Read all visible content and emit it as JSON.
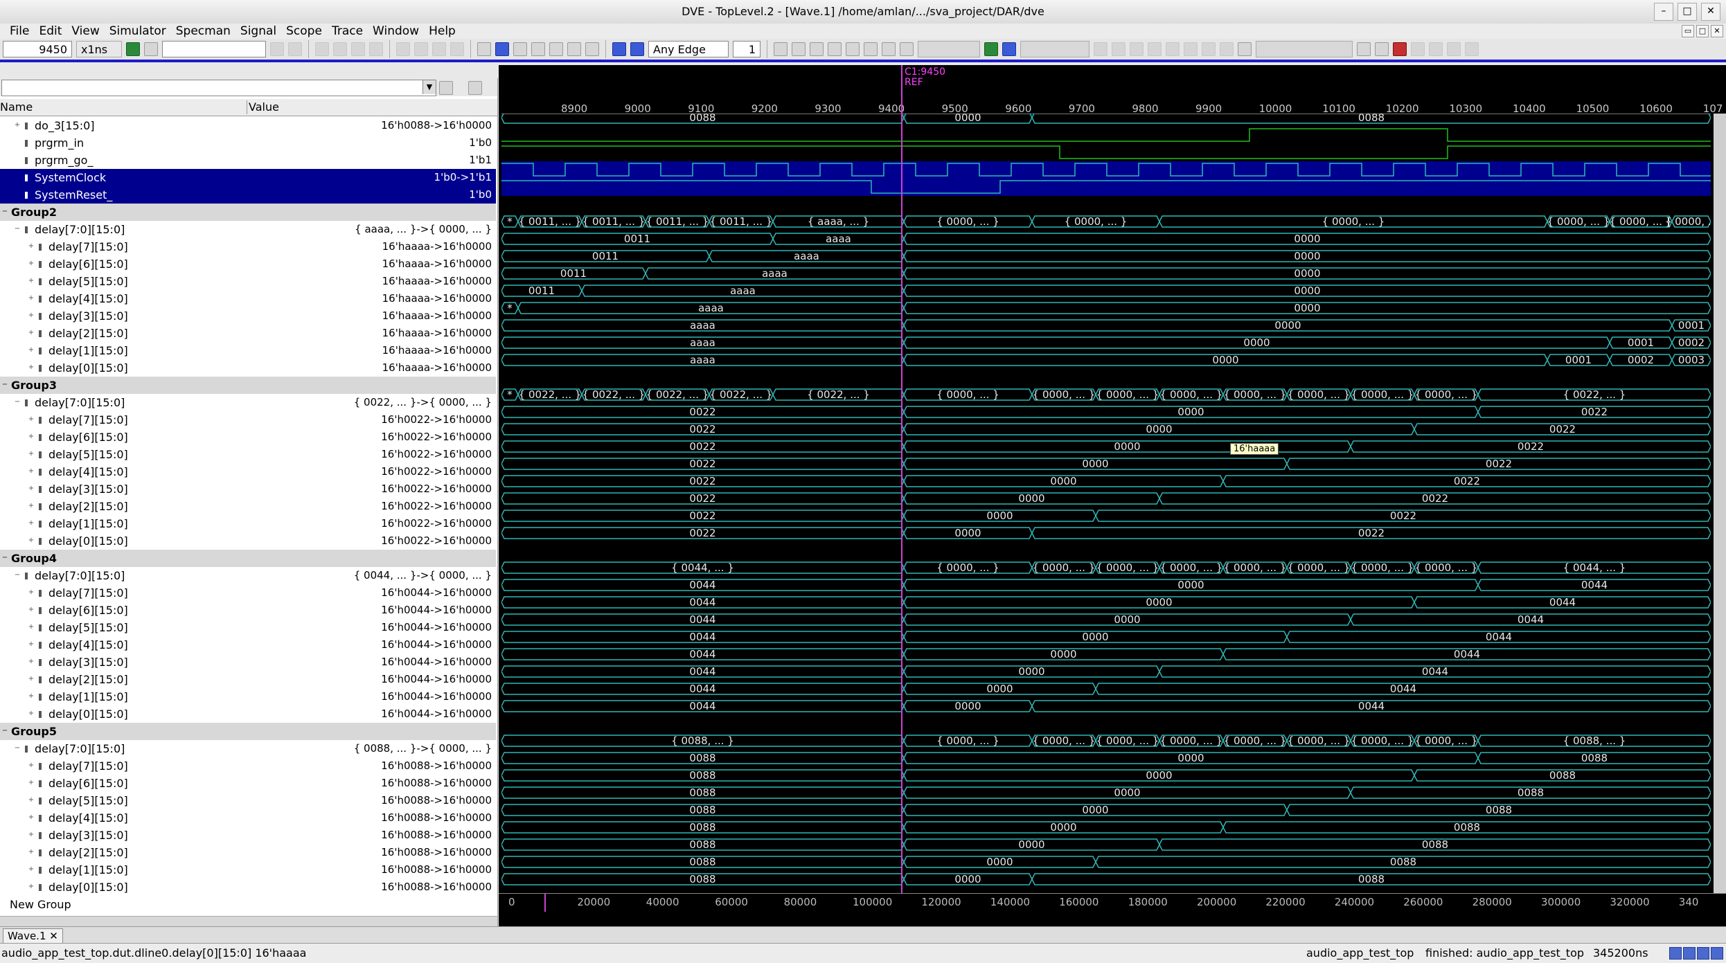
{
  "window": {
    "title": "DVE - TopLevel.2 - [Wave.1]  /home/amlan/.../sva_project/DAR/dve"
  },
  "menu": [
    "File",
    "Edit",
    "View",
    "Simulator",
    "Specman",
    "Signal",
    "Scope",
    "Trace",
    "Window",
    "Help"
  ],
  "toolbar": {
    "time_value": "9450",
    "time_unit": "x1ns",
    "edge_select": "Any Edge",
    "step_count": "1"
  },
  "columns": {
    "name": "Name",
    "value": "Value"
  },
  "colors": {
    "wave": "#2fb7b7",
    "bus": "#2fb7b7",
    "level1": "#20c020",
    "selection": "#00008e",
    "cursor": "#d040d0"
  },
  "signals": [
    {
      "name": "do_3[15:0]",
      "value": "16'h0088->16'h0000",
      "indent": 1,
      "exp": "+",
      "kind": "bus",
      "segs": [
        [
          0,
          0,
          "0088"
        ],
        [
          581,
          0,
          "0000"
        ],
        [
          766,
          0,
          "0088"
        ]
      ]
    },
    {
      "name": "prgrm_in",
      "value": "1'b0",
      "indent": 1,
      "kind": "bit",
      "levels": [
        [
          0,
          0
        ],
        [
          1080,
          1
        ],
        [
          1366,
          0
        ]
      ]
    },
    {
      "name": "prgrm_go_",
      "value": "1'b1",
      "indent": 1,
      "kind": "bit",
      "levels": [
        [
          0,
          1
        ],
        [
          806,
          0
        ],
        [
          1366,
          1
        ]
      ]
    },
    {
      "name": "SystemClock",
      "value": "1'b0->1'b1",
      "indent": 1,
      "kind": "clock",
      "sel": true
    },
    {
      "name": "SystemReset_",
      "value": "1'b0",
      "indent": 1,
      "kind": "bit",
      "sel": true,
      "levels": [
        [
          0,
          1
        ],
        [
          534,
          0
        ],
        [
          720,
          1
        ]
      ]
    },
    {
      "name": "Group2",
      "kind": "group"
    },
    {
      "name": "delay[7:0][15:0]",
      "value": "{ aaaa, ... }->{ 0000, ... }",
      "indent": 1,
      "exp": "-",
      "kind": "bus",
      "segs": [
        [
          0,
          0,
          "*"
        ],
        [
          24,
          0,
          "{ 0011, ... }"
        ],
        [
          116,
          0,
          "{ 0011, ... }"
        ],
        [
          208,
          0,
          "{ 0011, ... }"
        ],
        [
          300,
          0,
          "{ 0011, ... }"
        ],
        [
          392,
          0,
          "{ aaaa, ... }"
        ],
        [
          581,
          0,
          "{ 0000, ... }"
        ],
        [
          766,
          0,
          "{ 0000, ... }"
        ],
        [
          950,
          0,
          "{ 0000, ... }"
        ],
        [
          1510,
          0,
          "{ 0000, ... }"
        ],
        [
          1600,
          0,
          "{ 0000, ... }"
        ],
        [
          1690,
          0,
          "{ 0000, ..."
        ]
      ]
    },
    {
      "name": "delay[7][15:0]",
      "value": "16'haaaa->16'h0000",
      "indent": 2,
      "exp": "+",
      "kind": "bus",
      "segs": [
        [
          0,
          0,
          "0011"
        ],
        [
          392,
          0,
          "aaaa"
        ],
        [
          581,
          0,
          "0000"
        ]
      ]
    },
    {
      "name": "delay[6][15:0]",
      "value": "16'haaaa->16'h0000",
      "indent": 2,
      "exp": "+",
      "kind": "bus",
      "segs": [
        [
          0,
          0,
          "0011"
        ],
        [
          300,
          0,
          "aaaa"
        ],
        [
          581,
          0,
          "0000"
        ]
      ]
    },
    {
      "name": "delay[5][15:0]",
      "value": "16'haaaa->16'h0000",
      "indent": 2,
      "exp": "+",
      "kind": "bus",
      "segs": [
        [
          0,
          0,
          "0011"
        ],
        [
          208,
          0,
          "aaaa"
        ],
        [
          581,
          0,
          "0000"
        ]
      ]
    },
    {
      "name": "delay[4][15:0]",
      "value": "16'haaaa->16'h0000",
      "indent": 2,
      "exp": "+",
      "kind": "bus",
      "segs": [
        [
          0,
          0,
          "0011"
        ],
        [
          116,
          0,
          "aaaa"
        ],
        [
          581,
          0,
          "0000"
        ]
      ]
    },
    {
      "name": "delay[3][15:0]",
      "value": "16'haaaa->16'h0000",
      "indent": 2,
      "exp": "+",
      "kind": "bus",
      "segs": [
        [
          0,
          0,
          "*"
        ],
        [
          24,
          0,
          "aaaa"
        ],
        [
          581,
          0,
          "0000"
        ]
      ]
    },
    {
      "name": "delay[2][15:0]",
      "value": "16'haaaa->16'h0000",
      "indent": 2,
      "exp": "+",
      "kind": "bus",
      "segs": [
        [
          0,
          0,
          "aaaa"
        ],
        [
          581,
          0,
          "0000"
        ],
        [
          1690,
          0,
          "0001"
        ]
      ]
    },
    {
      "name": "delay[1][15:0]",
      "value": "16'haaaa->16'h0000",
      "indent": 2,
      "exp": "+",
      "kind": "bus",
      "segs": [
        [
          0,
          0,
          "aaaa"
        ],
        [
          581,
          0,
          "0000"
        ],
        [
          1600,
          0,
          "0001"
        ],
        [
          1690,
          0,
          "0002"
        ]
      ]
    },
    {
      "name": "delay[0][15:0]",
      "value": "16'haaaa->16'h0000",
      "indent": 2,
      "exp": "+",
      "kind": "bus",
      "segs": [
        [
          0,
          0,
          "aaaa"
        ],
        [
          581,
          0,
          "0000"
        ],
        [
          1510,
          0,
          "0001"
        ],
        [
          1600,
          0,
          "0002"
        ],
        [
          1690,
          0,
          "0003"
        ]
      ]
    },
    {
      "name": "Group3",
      "kind": "group"
    },
    {
      "name": "delay[7:0][15:0]",
      "value": "{ 0022, ... }->{ 0000, ... }",
      "indent": 1,
      "exp": "-",
      "kind": "bus",
      "segs": [
        [
          0,
          0,
          "*"
        ],
        [
          24,
          0,
          "{ 0022, ... }"
        ],
        [
          116,
          0,
          "{ 0022, ... }"
        ],
        [
          208,
          0,
          "{ 0022, ... }"
        ],
        [
          300,
          0,
          "{ 0022, ... }"
        ],
        [
          392,
          0,
          "{ 0022, ... }"
        ],
        [
          581,
          0,
          "{ 0000, ... }"
        ],
        [
          766,
          0,
          "{ 0000, ... }"
        ],
        [
          858,
          0,
          "{ 0000, ... }"
        ],
        [
          950,
          0,
          "{ 0000, ... }"
        ],
        [
          1042,
          0,
          "{ 0000, ... }"
        ],
        [
          1134,
          0,
          "{ 0000, ... }"
        ],
        [
          1226,
          0,
          "{ 0000, ... }"
        ],
        [
          1318,
          0,
          "{ 0000, ... }"
        ],
        [
          1410,
          0,
          "{ 0022, ... }"
        ]
      ]
    },
    {
      "name": "delay[7][15:0]",
      "value": "16'h0022->16'h0000",
      "indent": 2,
      "exp": "+",
      "kind": "bus",
      "segs": [
        [
          0,
          0,
          "0022"
        ],
        [
          581,
          0,
          "0000"
        ],
        [
          1410,
          0,
          "0022"
        ]
      ]
    },
    {
      "name": "delay[6][15:0]",
      "value": "16'h0022->16'h0000",
      "indent": 2,
      "exp": "+",
      "kind": "bus",
      "segs": [
        [
          0,
          0,
          "0022"
        ],
        [
          581,
          0,
          "0000"
        ],
        [
          1318,
          0,
          "0022"
        ]
      ]
    },
    {
      "name": "delay[5][15:0]",
      "value": "16'h0022->16'h0000",
      "indent": 2,
      "exp": "+",
      "kind": "bus",
      "segs": [
        [
          0,
          0,
          "0022"
        ],
        [
          581,
          0,
          "0000"
        ],
        [
          1226,
          0,
          "0022"
        ]
      ]
    },
    {
      "name": "delay[4][15:0]",
      "value": "16'h0022->16'h0000",
      "indent": 2,
      "exp": "+",
      "kind": "bus",
      "segs": [
        [
          0,
          0,
          "0022"
        ],
        [
          581,
          0,
          "0000"
        ],
        [
          1134,
          0,
          "0022"
        ]
      ]
    },
    {
      "name": "delay[3][15:0]",
      "value": "16'h0022->16'h0000",
      "indent": 2,
      "exp": "+",
      "kind": "bus",
      "segs": [
        [
          0,
          0,
          "0022"
        ],
        [
          581,
          0,
          "0000"
        ],
        [
          1042,
          0,
          "0022"
        ]
      ]
    },
    {
      "name": "delay[2][15:0]",
      "value": "16'h0022->16'h0000",
      "indent": 2,
      "exp": "+",
      "kind": "bus",
      "segs": [
        [
          0,
          0,
          "0022"
        ],
        [
          581,
          0,
          "0000"
        ],
        [
          950,
          0,
          "0022"
        ]
      ]
    },
    {
      "name": "delay[1][15:0]",
      "value": "16'h0022->16'h0000",
      "indent": 2,
      "exp": "+",
      "kind": "bus",
      "segs": [
        [
          0,
          0,
          "0022"
        ],
        [
          581,
          0,
          "0000"
        ],
        [
          858,
          0,
          "0022"
        ]
      ]
    },
    {
      "name": "delay[0][15:0]",
      "value": "16'h0022->16'h0000",
      "indent": 2,
      "exp": "+",
      "kind": "bus",
      "segs": [
        [
          0,
          0,
          "0022"
        ],
        [
          581,
          0,
          "0000"
        ],
        [
          766,
          0,
          "0022"
        ]
      ]
    },
    {
      "name": "Group4",
      "kind": "group"
    },
    {
      "name": "delay[7:0][15:0]",
      "value": "{ 0044, ... }->{ 0000, ... }",
      "indent": 1,
      "exp": "-",
      "kind": "bus",
      "segs": [
        [
          0,
          0,
          "{ 0044, ... }"
        ],
        [
          581,
          0,
          "{ 0000, ... }"
        ],
        [
          766,
          0,
          "{ 0000, ... }"
        ],
        [
          858,
          0,
          "{ 0000, ... }"
        ],
        [
          950,
          0,
          "{ 0000, ... }"
        ],
        [
          1042,
          0,
          "{ 0000, ... }"
        ],
        [
          1134,
          0,
          "{ 0000, ... }"
        ],
        [
          1226,
          0,
          "{ 0000, ... }"
        ],
        [
          1318,
          0,
          "{ 0000, ... }"
        ],
        [
          1410,
          0,
          "{ 0044, ... }"
        ]
      ]
    },
    {
      "name": "delay[7][15:0]",
      "value": "16'h0044->16'h0000",
      "indent": 2,
      "exp": "+",
      "kind": "bus",
      "segs": [
        [
          0,
          0,
          "0044"
        ],
        [
          581,
          0,
          "0000"
        ],
        [
          1410,
          0,
          "0044"
        ]
      ]
    },
    {
      "name": "delay[6][15:0]",
      "value": "16'h0044->16'h0000",
      "indent": 2,
      "exp": "+",
      "kind": "bus",
      "segs": [
        [
          0,
          0,
          "0044"
        ],
        [
          581,
          0,
          "0000"
        ],
        [
          1318,
          0,
          "0044"
        ]
      ]
    },
    {
      "name": "delay[5][15:0]",
      "value": "16'h0044->16'h0000",
      "indent": 2,
      "exp": "+",
      "kind": "bus",
      "segs": [
        [
          0,
          0,
          "0044"
        ],
        [
          581,
          0,
          "0000"
        ],
        [
          1226,
          0,
          "0044"
        ]
      ]
    },
    {
      "name": "delay[4][15:0]",
      "value": "16'h0044->16'h0000",
      "indent": 2,
      "exp": "+",
      "kind": "bus",
      "segs": [
        [
          0,
          0,
          "0044"
        ],
        [
          581,
          0,
          "0000"
        ],
        [
          1134,
          0,
          "0044"
        ]
      ]
    },
    {
      "name": "delay[3][15:0]",
      "value": "16'h0044->16'h0000",
      "indent": 2,
      "exp": "+",
      "kind": "bus",
      "segs": [
        [
          0,
          0,
          "0044"
        ],
        [
          581,
          0,
          "0000"
        ],
        [
          1042,
          0,
          "0044"
        ]
      ]
    },
    {
      "name": "delay[2][15:0]",
      "value": "16'h0044->16'h0000",
      "indent": 2,
      "exp": "+",
      "kind": "bus",
      "segs": [
        [
          0,
          0,
          "0044"
        ],
        [
          581,
          0,
          "0000"
        ],
        [
          950,
          0,
          "0044"
        ]
      ]
    },
    {
      "name": "delay[1][15:0]",
      "value": "16'h0044->16'h0000",
      "indent": 2,
      "exp": "+",
      "kind": "bus",
      "segs": [
        [
          0,
          0,
          "0044"
        ],
        [
          581,
          0,
          "0000"
        ],
        [
          858,
          0,
          "0044"
        ]
      ]
    },
    {
      "name": "delay[0][15:0]",
      "value": "16'h0044->16'h0000",
      "indent": 2,
      "exp": "+",
      "kind": "bus",
      "segs": [
        [
          0,
          0,
          "0044"
        ],
        [
          581,
          0,
          "0000"
        ],
        [
          766,
          0,
          "0044"
        ]
      ]
    },
    {
      "name": "Group5",
      "kind": "group"
    },
    {
      "name": "delay[7:0][15:0]",
      "value": "{ 0088, ... }->{ 0000, ... }",
      "indent": 1,
      "exp": "-",
      "kind": "bus",
      "segs": [
        [
          0,
          0,
          "{ 0088, ... }"
        ],
        [
          581,
          0,
          "{ 0000, ... }"
        ],
        [
          766,
          0,
          "{ 0000, ... }"
        ],
        [
          858,
          0,
          "{ 0000, ... }"
        ],
        [
          950,
          0,
          "{ 0000, ... }"
        ],
        [
          1042,
          0,
          "{ 0000, ... }"
        ],
        [
          1134,
          0,
          "{ 0000, ... }"
        ],
        [
          1226,
          0,
          "{ 0000, ... }"
        ],
        [
          1318,
          0,
          "{ 0000, ... }"
        ],
        [
          1410,
          0,
          "{ 0088, ... }"
        ]
      ]
    },
    {
      "name": "delay[7][15:0]",
      "value": "16'h0088->16'h0000",
      "indent": 2,
      "exp": "+",
      "kind": "bus",
      "segs": [
        [
          0,
          0,
          "0088"
        ],
        [
          581,
          0,
          "0000"
        ],
        [
          1410,
          0,
          "0088"
        ]
      ]
    },
    {
      "name": "delay[6][15:0]",
      "value": "16'h0088->16'h0000",
      "indent": 2,
      "exp": "+",
      "kind": "bus",
      "segs": [
        [
          0,
          0,
          "0088"
        ],
        [
          581,
          0,
          "0000"
        ],
        [
          1318,
          0,
          "0088"
        ]
      ]
    },
    {
      "name": "delay[5][15:0]",
      "value": "16'h0088->16'h0000",
      "indent": 2,
      "exp": "+",
      "kind": "bus",
      "segs": [
        [
          0,
          0,
          "0088"
        ],
        [
          581,
          0,
          "0000"
        ],
        [
          1226,
          0,
          "0088"
        ]
      ]
    },
    {
      "name": "delay[4][15:0]",
      "value": "16'h0088->16'h0000",
      "indent": 2,
      "exp": "+",
      "kind": "bus",
      "segs": [
        [
          0,
          0,
          "0088"
        ],
        [
          581,
          0,
          "0000"
        ],
        [
          1134,
          0,
          "0088"
        ]
      ]
    },
    {
      "name": "delay[3][15:0]",
      "value": "16'h0088->16'h0000",
      "indent": 2,
      "exp": "+",
      "kind": "bus",
      "segs": [
        [
          0,
          0,
          "0088"
        ],
        [
          581,
          0,
          "0000"
        ],
        [
          1042,
          0,
          "0088"
        ]
      ]
    },
    {
      "name": "delay[2][15:0]",
      "value": "16'h0088->16'h0000",
      "indent": 2,
      "exp": "+",
      "kind": "bus",
      "segs": [
        [
          0,
          0,
          "0088"
        ],
        [
          581,
          0,
          "0000"
        ],
        [
          950,
          0,
          "0088"
        ]
      ]
    },
    {
      "name": "delay[1][15:0]",
      "value": "16'h0088->16'h0000",
      "indent": 2,
      "exp": "+",
      "kind": "bus",
      "segs": [
        [
          0,
          0,
          "0088"
        ],
        [
          581,
          0,
          "0000"
        ],
        [
          858,
          0,
          "0088"
        ]
      ]
    },
    {
      "name": "delay[0][15:0]",
      "value": "16'h0088->16'h0000",
      "indent": 2,
      "exp": "+",
      "kind": "bus",
      "segs": [
        [
          0,
          0,
          "0088"
        ],
        [
          581,
          0,
          "0000"
        ],
        [
          766,
          0,
          "0088"
        ]
      ]
    },
    {
      "name": "New Group",
      "kind": "newgroup"
    }
  ],
  "ruler": {
    "ticks": [
      "8900",
      "9000",
      "9100",
      "9200",
      "9300",
      "9400",
      "9500",
      "9600",
      "9700",
      "9800",
      "9900",
      "10000",
      "10100",
      "10200",
      "10300",
      "10400",
      "10500",
      "10600",
      "107"
    ]
  },
  "cursor": {
    "label": "C1:9450",
    "ref": "REF"
  },
  "tooltip": "16'haaaa",
  "overview": {
    "ticks": [
      "0",
      "20000",
      "40000",
      "60000",
      "80000",
      "100000",
      "120000",
      "140000",
      "160000",
      "180000",
      "200000",
      "220000",
      "240000",
      "260000",
      "280000",
      "300000",
      "320000",
      "340"
    ]
  },
  "tabs": [
    "Wave.1"
  ],
  "status": {
    "path": "audio_app_test_top.dut.dline0.delay[0][15:0] 16'haaaa",
    "scope": "audio_app_test_top",
    "sim": "finished: audio_app_test_top",
    "time": "345200ns"
  }
}
